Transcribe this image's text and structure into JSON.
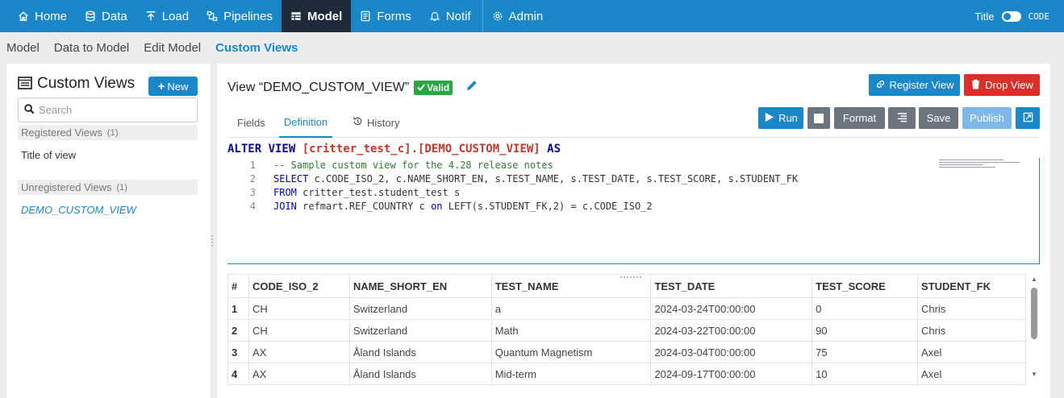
{
  "topnav": {
    "items": [
      {
        "label": "Home",
        "icon": "home-icon"
      },
      {
        "label": "Data",
        "icon": "database-icon"
      },
      {
        "label": "Load",
        "icon": "upload-icon"
      },
      {
        "label": "Pipelines",
        "icon": "pipelines-icon"
      },
      {
        "label": "Model",
        "icon": "table-icon",
        "active": true
      },
      {
        "label": "Forms",
        "icon": "form-icon"
      },
      {
        "label": "Notif",
        "icon": "bell-icon"
      },
      {
        "label": "Admin",
        "icon": "gear-icon"
      }
    ],
    "toggle_left": "Title",
    "toggle_right": "CODE"
  },
  "subnav": {
    "items": [
      "Model",
      "Data to Model",
      "Edit Model",
      "Custom Views"
    ],
    "active": "Custom Views"
  },
  "sidebar": {
    "title": "Custom Views",
    "new_label": "New",
    "search_placeholder": "Search",
    "registered": {
      "label": "Registered Views",
      "count": "(1)",
      "items": [
        "Title of view"
      ]
    },
    "unregistered": {
      "label": "Unregistered Views",
      "count": "(1)",
      "items": [
        "DEMO_CUSTOM_VIEW"
      ]
    }
  },
  "main": {
    "view_title": "View “DEMO_CUSTOM_VIEW”",
    "valid_label": "Valid",
    "register_label": "Register View",
    "drop_label": "Drop View",
    "tabs": [
      "Fields",
      "Definition",
      "History"
    ],
    "active_tab": "Definition",
    "toolbar": {
      "run": "Run",
      "format": "Format",
      "save": "Save",
      "publish": "Publish"
    },
    "sql_header": {
      "kw1": "ALTER VIEW ",
      "table": "[critter_test_c].[DEMO_CUSTOM_VIEW]",
      "kw2": " AS"
    },
    "code_lines": [
      {
        "n": "1",
        "comment": "-- Sample custom view for the 4.28 release notes"
      },
      {
        "n": "2",
        "kw": "SELECT",
        "text": " c.CODE_ISO_2, c.NAME_SHORT_EN, s.TEST_NAME, s.TEST_DATE, s.TEST_SCORE, s.STUDENT_FK"
      },
      {
        "n": "3",
        "kw": "FROM",
        "text": " critter_test.student_test s"
      },
      {
        "n": "4",
        "kw": "JOIN",
        "text": " refmart.REF_COUNTRY c ",
        "kw2": "on",
        "text2": " LEFT(s.STUDENT_FK,2) = c.CODE_ISO_2"
      }
    ],
    "table": {
      "columns": [
        "#",
        "CODE_ISO_2",
        "NAME_SHORT_EN",
        "TEST_NAME",
        "TEST_DATE",
        "TEST_SCORE",
        "STUDENT_FK"
      ],
      "rows": [
        [
          "1",
          "CH",
          "Switzerland",
          "a",
          "2024-03-24T00:00:00",
          "0",
          "Chris"
        ],
        [
          "2",
          "CH",
          "Switzerland",
          "Math",
          "2024-03-22T00:00:00",
          "90",
          "Chris"
        ],
        [
          "3",
          "AX",
          "Åland Islands",
          "Quantum Magnetism",
          "2024-03-04T00:00:00",
          "75",
          "Axel"
        ],
        [
          "4",
          "AX",
          "Åland Islands",
          "Mid-term",
          "2024-09-17T00:00:00",
          "10",
          "Axel"
        ]
      ]
    }
  }
}
